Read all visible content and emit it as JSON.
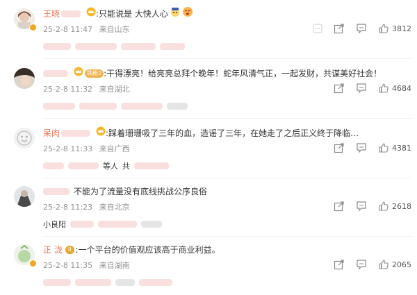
{
  "comments": [
    {
      "text": "只能说是 大快人心",
      "date": "25-2-8 11:47",
      "location": "来自山东",
      "likes": "3812",
      "username_visible": "王晓",
      "reply_texts": []
    },
    {
      "text": "干得漂亮！给亮亮总拜个晚年！蛇年风清气正，一起发财，共谋美好社会！",
      "date": "25-2-8 11:32",
      "location": "来自湖北",
      "likes": "4684",
      "badge_label": "铁粉2",
      "username_visible": "",
      "reply_texts": []
    },
    {
      "text": "踩着珊珊吸了三年的血，造谣了三年，在她走了之后正义终于降临…",
      "date": "25-2-8 11:33",
      "location": "来自广西",
      "likes": "4381",
      "username_visible": "呆肉",
      "reply_texts": [
        "等人",
        "共"
      ]
    },
    {
      "text": "不能为了流量没有底线挑战公序良俗",
      "date": "25-2-8 11:23",
      "location": "来自北京",
      "likes": "2618",
      "username_visible": "",
      "reply_texts": [
        "小良阳"
      ]
    },
    {
      "text": "一个平台的价值观应该高于商业利益。",
      "date": "25-2-8 11:35",
      "location": "来自湖南",
      "likes": "2065",
      "badge_label": "II",
      "username_visible": "正 泷",
      "reply_texts": []
    }
  ],
  "icons": {
    "more": "more-icon",
    "share": "share-icon",
    "comment": "comment-icon",
    "like": "thumb-up-icon"
  },
  "colors": {
    "username": "#eb7350",
    "meta": "#939393",
    "blur_pink": "#f7d6d4",
    "icon": "#8a8a8a"
  }
}
